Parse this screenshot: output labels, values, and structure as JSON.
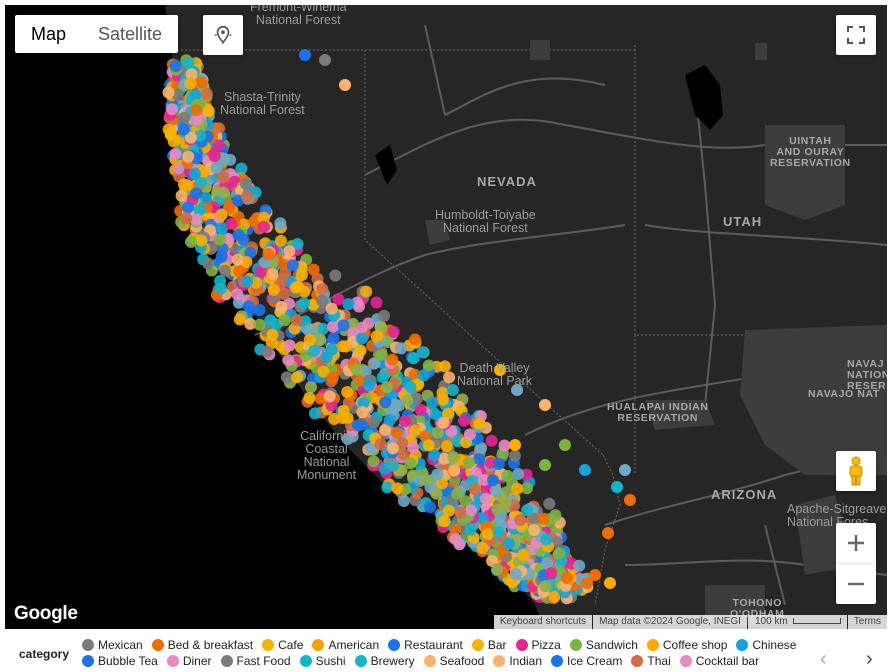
{
  "map_type": {
    "map_label": "Map",
    "satellite_label": "Satellite",
    "selected": "Map"
  },
  "map_labels": {
    "forest_top": "Fremont-Winema\nNational Forest",
    "shasta": "Shasta-Trinity\nNational Forest",
    "nevada": "NEVADA",
    "humboldt": "Humboldt-Toiyabe\nNational Forest",
    "utah": "UTAH",
    "uintah": "UINTAH\nAND OURAY\nRESERVATION",
    "death_valley": "Death Valley\nNational Park",
    "hualapai": "HUALAPAI INDIAN\nRESERVATION",
    "navajo_ne": "NAVAJ\nNATION\nRESER",
    "navajo_nation": "NAVAJO NAT",
    "california_coastal": "California\nCoastal\nNational\nMonument",
    "arizona": "ARIZONA",
    "apache": "Apache-Sitgreave\nNational Fores",
    "tohono": "TOHONO\nO'ODHAM"
  },
  "icons": {
    "geolocate": "locate-icon",
    "fullscreen": "fullscreen-icon",
    "pegman": "pegman-icon",
    "zoom_in": "plus-icon",
    "zoom_out": "minus-icon"
  },
  "footer": {
    "shortcuts": "Keyboard shortcuts",
    "attribution": "Map data ©2024 Google, INEGI",
    "scale": "100 km",
    "terms": "Terms"
  },
  "logo_text": "Google",
  "legend": {
    "title": "category",
    "row1": [
      {
        "label": "Mexican",
        "color": "#7b7b7b"
      },
      {
        "label": "Bed & breakfast",
        "color": "#ef6c00"
      },
      {
        "label": "Cafe",
        "color": "#f4b400"
      },
      {
        "label": "American",
        "color": "#f4a300"
      },
      {
        "label": "Restaurant",
        "color": "#1a73e8"
      },
      {
        "label": "Bar",
        "color": "#f4b400"
      },
      {
        "label": "Pizza",
        "color": "#e52592"
      },
      {
        "label": "Sandwich",
        "color": "#7cb342"
      },
      {
        "label": "Coffee shop",
        "color": "#f9ab00"
      },
      {
        "label": "Chinese",
        "color": "#12a4d9"
      }
    ],
    "row2": [
      {
        "label": "Bubble Tea",
        "color": "#1a73e8"
      },
      {
        "label": "Diner",
        "color": "#e78ac3"
      },
      {
        "label": "Fast Food",
        "color": "#7b7b7b"
      },
      {
        "label": "Sushi",
        "color": "#12b5cb"
      },
      {
        "label": "Brewery",
        "color": "#12b5cb"
      },
      {
        "label": "Seafood",
        "color": "#fbb26a"
      },
      {
        "label": "Indian",
        "color": "#fbb26a"
      },
      {
        "label": "Ice Cream",
        "color": "#1a73e8"
      },
      {
        "label": "Thai",
        "color": "#d46a43"
      },
      {
        "label": "Cocktail bar",
        "color": "#e78ac3"
      }
    ]
  }
}
